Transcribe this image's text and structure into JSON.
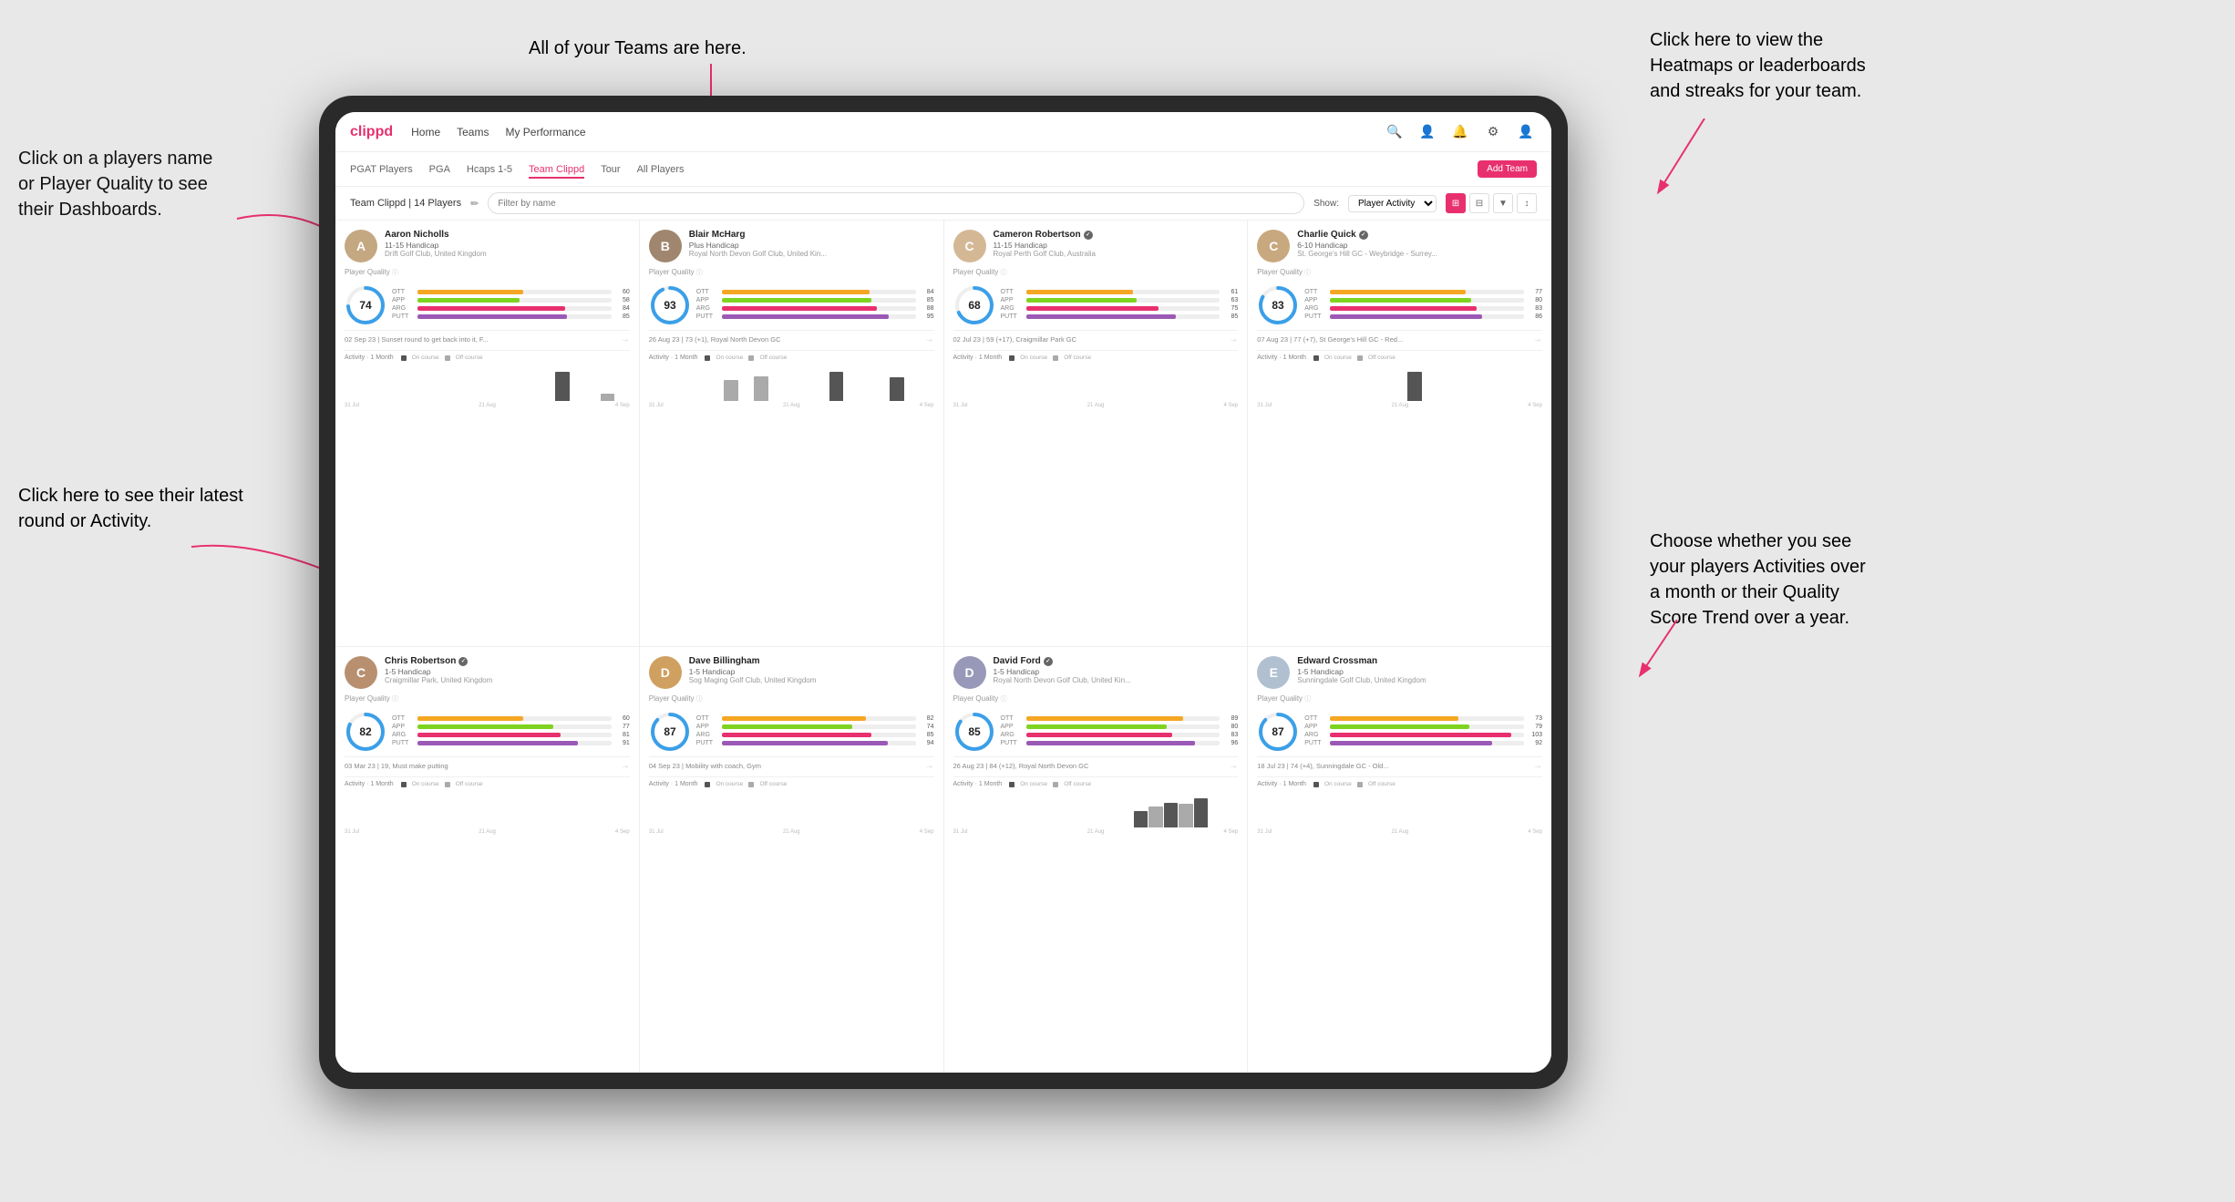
{
  "annotations": {
    "click_player": "Click on a players name\nor Player Quality to see\ntheir Dashboards.",
    "teams_here": "All of your Teams are here.",
    "heatmaps": "Click here to view the\nHeatmaps or leaderboards\nand streaks for your team.",
    "latest_round": "Click here to see their latest\nround or Activity.",
    "activities_choice": "Choose whether you see\nyour players Activities over\na month or their Quality\nScore Trend over a year."
  },
  "nav": {
    "logo": "clippd",
    "items": [
      "Home",
      "Teams",
      "My Performance"
    ],
    "icons": [
      "🔍",
      "👤",
      "🔔",
      "⚙",
      "👤"
    ]
  },
  "subnav": {
    "items": [
      "PGAT Players",
      "PGA",
      "Hcaps 1-5",
      "Team Clippd",
      "Tour",
      "All Players"
    ],
    "active": "Team Clippd",
    "add_button": "Add Team"
  },
  "toolbar": {
    "title": "Team Clippd | 14 Players",
    "edit_icon": "✏",
    "search_placeholder": "Filter by name",
    "show_label": "Show:",
    "show_options": [
      "Player Activity"
    ],
    "view_buttons": [
      "⊞",
      "⊟",
      "▼",
      "↕"
    ]
  },
  "players": [
    {
      "name": "Aaron Nicholls",
      "handicap": "11-15 Handicap",
      "club": "Drift Golf Club, United Kingdom",
      "verified": false,
      "quality": 74,
      "stats": {
        "OTT": {
          "value": 60,
          "color": "#f5a623"
        },
        "APP": {
          "value": 58,
          "color": "#7ed321"
        },
        "ARG": {
          "value": 84,
          "color": "#e8306e"
        },
        "PUTT": {
          "value": 85,
          "color": "#9b59b6"
        }
      },
      "last_round": "02 Sep 23 | Sunset round to get back into it, F...",
      "activity_label": "Activity · 1 Month",
      "bars": [
        0,
        0,
        0,
        0,
        0,
        0,
        0,
        0,
        0,
        0,
        0,
        0,
        0,
        0,
        20,
        0,
        0,
        5,
        0
      ],
      "dates": [
        "31 Jul",
        "21 Aug",
        "4 Sep"
      ]
    },
    {
      "name": "Blair McHarg",
      "handicap": "Plus Handicap",
      "club": "Royal North Devon Golf Club, United Kin...",
      "verified": false,
      "quality": 93,
      "stats": {
        "OTT": {
          "value": 84,
          "color": "#f5a623"
        },
        "APP": {
          "value": 85,
          "color": "#7ed321"
        },
        "ARG": {
          "value": 88,
          "color": "#e8306e"
        },
        "PUTT": {
          "value": 95,
          "color": "#9b59b6"
        }
      },
      "last_round": "26 Aug 23 | 73 (+1), Royal North Devon GC",
      "activity_label": "Activity · 1 Month",
      "bars": [
        0,
        0,
        0,
        0,
        0,
        25,
        0,
        30,
        0,
        0,
        0,
        0,
        35,
        0,
        0,
        0,
        28,
        0,
        0
      ],
      "dates": [
        "31 Jul",
        "21 Aug",
        "4 Sep"
      ]
    },
    {
      "name": "Cameron Robertson",
      "handicap": "11-15 Handicap",
      "club": "Royal Perth Golf Club, Australia",
      "verified": true,
      "quality": 68,
      "stats": {
        "OTT": {
          "value": 61,
          "color": "#f5a623"
        },
        "APP": {
          "value": 63,
          "color": "#7ed321"
        },
        "ARG": {
          "value": 75,
          "color": "#e8306e"
        },
        "PUTT": {
          "value": 85,
          "color": "#9b59b6"
        }
      },
      "last_round": "02 Jul 23 | 59 (+17), Craigmillar Park GC",
      "activity_label": "Activity · 1 Month",
      "bars": [
        0,
        0,
        0,
        0,
        0,
        0,
        0,
        0,
        0,
        0,
        0,
        0,
        0,
        0,
        0,
        0,
        0,
        0,
        0
      ],
      "dates": [
        "31 Jul",
        "21 Aug",
        "4 Sep"
      ]
    },
    {
      "name": "Charlie Quick",
      "handicap": "6-10 Handicap",
      "club": "St. George's Hill GC - Weybridge - Surrey...",
      "verified": true,
      "quality": 83,
      "stats": {
        "OTT": {
          "value": 77,
          "color": "#f5a623"
        },
        "APP": {
          "value": 80,
          "color": "#7ed321"
        },
        "ARG": {
          "value": 83,
          "color": "#e8306e"
        },
        "PUTT": {
          "value": 86,
          "color": "#9b59b6"
        }
      },
      "last_round": "07 Aug 23 | 77 (+7), St George's Hill GC - Red...",
      "activity_label": "Activity · 1 Month",
      "bars": [
        0,
        0,
        0,
        0,
        0,
        0,
        0,
        0,
        0,
        0,
        18,
        0,
        0,
        0,
        0,
        0,
        0,
        0,
        0
      ],
      "dates": [
        "31 Jul",
        "21 Aug",
        "4 Sep"
      ]
    },
    {
      "name": "Chris Robertson",
      "handicap": "1-5 Handicap",
      "club": "Craigmillar Park, United Kingdom",
      "verified": true,
      "quality": 82,
      "stats": {
        "OTT": {
          "value": 60,
          "color": "#f5a623"
        },
        "APP": {
          "value": 77,
          "color": "#7ed321"
        },
        "ARG": {
          "value": 81,
          "color": "#e8306e"
        },
        "PUTT": {
          "value": 91,
          "color": "#9b59b6"
        }
      },
      "last_round": "03 Mar 23 | 19, Must make putting",
      "activity_label": "Activity · 1 Month",
      "bars": [
        0,
        0,
        0,
        0,
        0,
        0,
        0,
        0,
        0,
        0,
        0,
        0,
        0,
        0,
        0,
        0,
        0,
        0,
        0
      ],
      "dates": [
        "31 Jul",
        "21 Aug",
        "4 Sep"
      ]
    },
    {
      "name": "Dave Billingham",
      "handicap": "1-5 Handicap",
      "club": "Sog Maging Golf Club, United Kingdom",
      "verified": false,
      "quality": 87,
      "stats": {
        "OTT": {
          "value": 82,
          "color": "#f5a623"
        },
        "APP": {
          "value": 74,
          "color": "#7ed321"
        },
        "ARG": {
          "value": 85,
          "color": "#e8306e"
        },
        "PUTT": {
          "value": 94,
          "color": "#9b59b6"
        }
      },
      "last_round": "04 Sep 23 | Mobility with coach, Gym",
      "activity_label": "Activity · 1 Month",
      "bars": [
        0,
        0,
        0,
        0,
        0,
        0,
        0,
        0,
        0,
        0,
        0,
        0,
        0,
        0,
        0,
        0,
        0,
        0,
        0
      ],
      "dates": [
        "31 Jul",
        "21 Aug",
        "4 Sep"
      ]
    },
    {
      "name": "David Ford",
      "handicap": "1-5 Handicap",
      "club": "Royal North Devon Golf Club, United Kin...",
      "verified": true,
      "quality": 85,
      "stats": {
        "OTT": {
          "value": 89,
          "color": "#f5a623"
        },
        "APP": {
          "value": 80,
          "color": "#7ed321"
        },
        "ARG": {
          "value": 83,
          "color": "#e8306e"
        },
        "PUTT": {
          "value": 96,
          "color": "#9b59b6"
        }
      },
      "last_round": "26 Aug 23 | 84 (+12), Royal North Devon GC",
      "activity_label": "Activity · 1 Month",
      "bars": [
        0,
        0,
        0,
        0,
        0,
        0,
        0,
        0,
        0,
        0,
        0,
        0,
        20,
        25,
        30,
        28,
        35,
        0,
        0
      ],
      "dates": [
        "31 Jul",
        "21 Aug",
        "4 Sep"
      ]
    },
    {
      "name": "Edward Crossman",
      "handicap": "1-5 Handicap",
      "club": "Sunningdale Golf Club, United Kingdom",
      "verified": false,
      "quality": 87,
      "stats": {
        "OTT": {
          "value": 73,
          "color": "#f5a623"
        },
        "APP": {
          "value": 79,
          "color": "#7ed321"
        },
        "ARG": {
          "value": 103,
          "color": "#e8306e"
        },
        "PUTT": {
          "value": 92,
          "color": "#9b59b6"
        }
      },
      "last_round": "18 Jul 23 | 74 (+4), Sunningdale GC - Old...",
      "activity_label": "Activity · 1 Month",
      "bars": [
        0,
        0,
        0,
        0,
        0,
        0,
        0,
        0,
        0,
        0,
        0,
        0,
        0,
        0,
        0,
        0,
        0,
        0,
        0
      ],
      "dates": [
        "31 Jul",
        "21 Aug",
        "4 Sep"
      ]
    }
  ],
  "colors": {
    "primary": "#e8306e",
    "quality_circle_bg": "#eee",
    "quality_circle_stroke": "#3b9fe8",
    "on_course_bar": "#555",
    "off_course_bar": "#aaa"
  }
}
